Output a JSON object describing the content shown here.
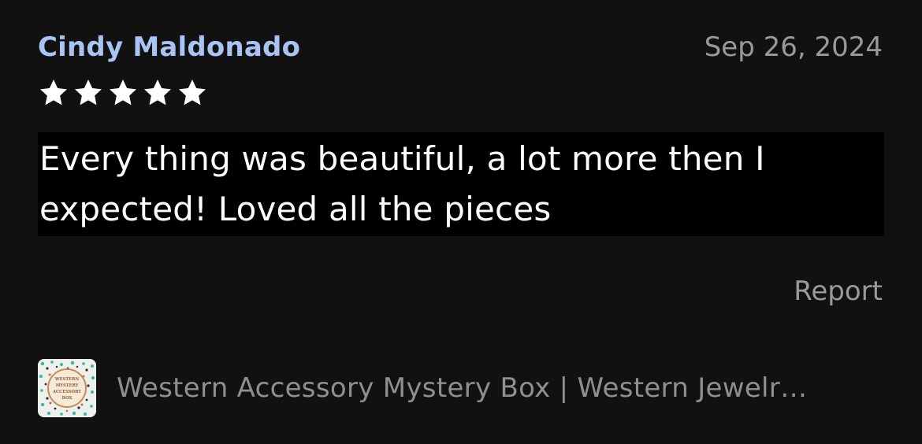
{
  "review": {
    "reviewer_name": "Cindy Maldonado",
    "date": "Sep 26, 2024",
    "rating": 5,
    "rating_max": 5,
    "text": "Every thing was beautiful, a lot more then I expected! Loved all the pieces",
    "report_label": "Report"
  },
  "listing": {
    "title": "Western Accessory Mystery Box | Western Jewelr…",
    "thumbnail_text": "WESTERN MYSTERY ACCESSORY BOX"
  },
  "colors": {
    "background": "#111111",
    "reviewer_link": "#a9c4f2",
    "muted_text": "#9a9a9a",
    "star": "#ffffff",
    "highlight_background": "#000000"
  },
  "icons": {
    "star": "star-icon"
  }
}
